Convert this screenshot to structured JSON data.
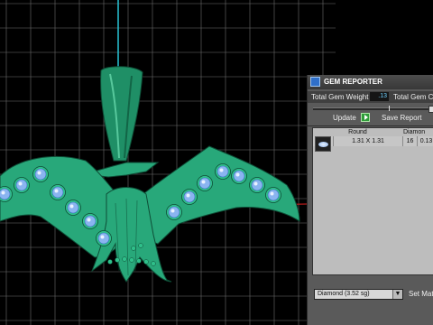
{
  "viewport": {
    "background": "#000000",
    "grid_color": "#6e6e6e",
    "axis_y_color": "#29c4d6",
    "axis_x_color": "#e02020",
    "model_color": "#28a87a",
    "gem_color": "#8ab4f0"
  },
  "panel": {
    "title": "GEM REPORTER",
    "total_gem_weight_label": "Total Gem Weight",
    "total_gem_weight_value": ".13",
    "total_gem_count_label": "Total Gem C",
    "update_label": "Update",
    "save_report_label": "Save Report",
    "table": {
      "headers": [
        "Round",
        "Diamon"
      ],
      "rows": [
        {
          "size": "1.31 X 1.31",
          "count": "16",
          "weight": "0.13"
        }
      ]
    },
    "material_select": "Diamond",
    "material_sg": "(3.52 sg)",
    "set_material_label": "Set Mat"
  }
}
